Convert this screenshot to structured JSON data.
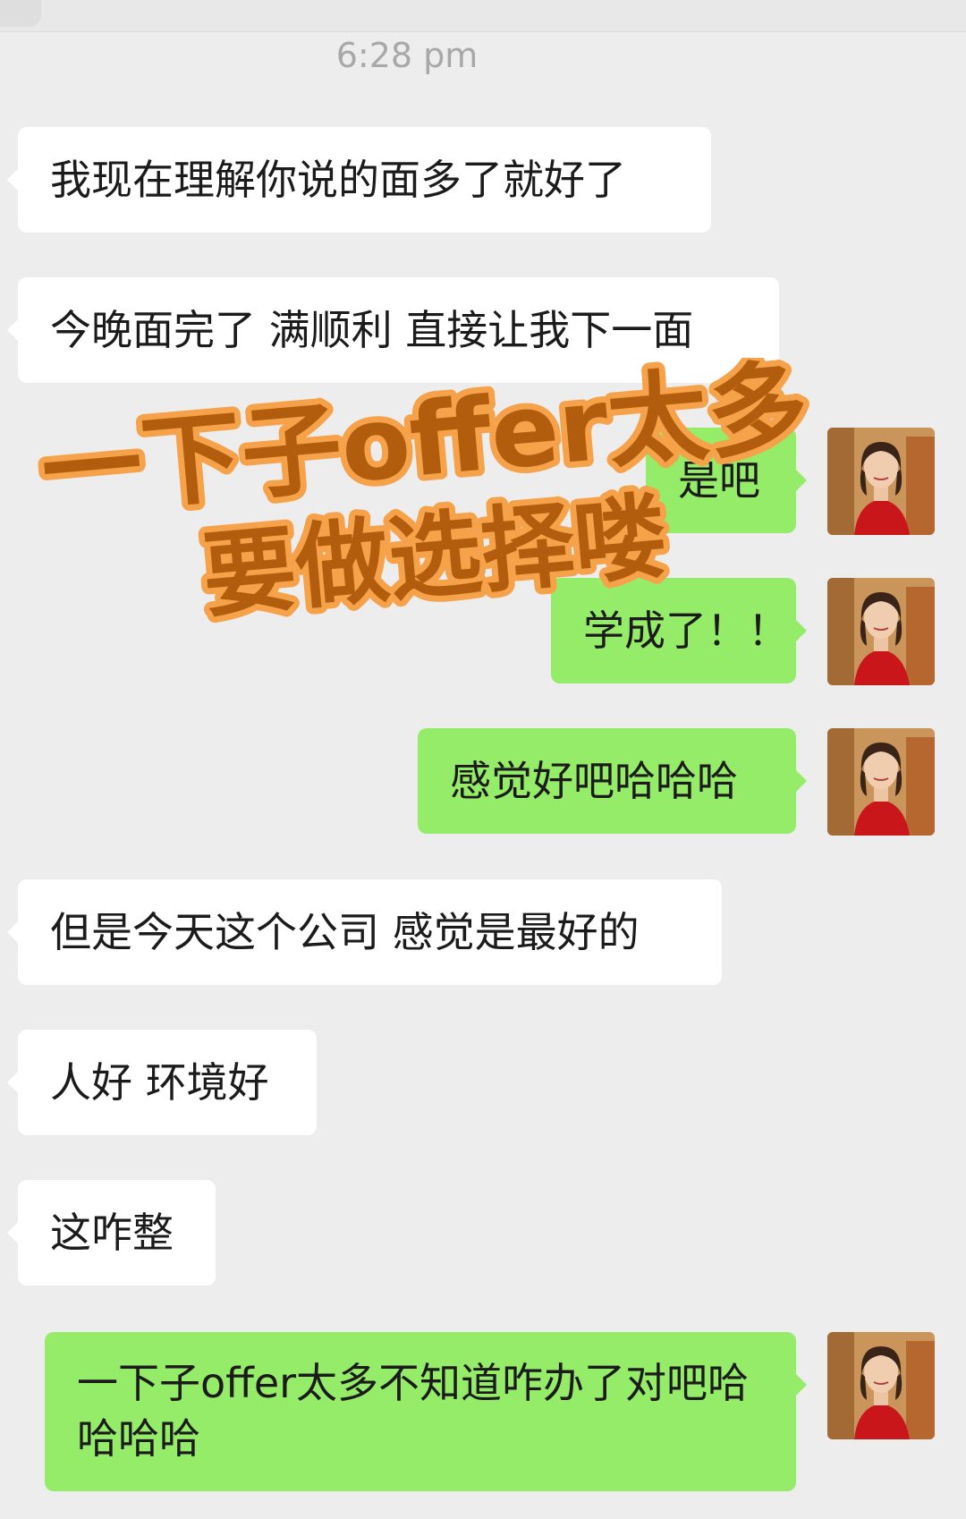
{
  "chat": {
    "timestamp": "6:28 pm",
    "messages": [
      {
        "side": "recv",
        "text": "我现在理解你说的面多了就好了"
      },
      {
        "side": "recv",
        "text": "今晚面完了 满顺利 直接让我下一面"
      },
      {
        "side": "sent",
        "text": "是吧"
      },
      {
        "side": "sent",
        "text": "学成了！！"
      },
      {
        "side": "sent",
        "text": "感觉好吧哈哈哈"
      },
      {
        "side": "recv",
        "text": "但是今天这个公司 感觉是最好的"
      },
      {
        "side": "recv",
        "text": "人好 环境好"
      },
      {
        "side": "recv",
        "text": "这咋整"
      },
      {
        "side": "sent",
        "text": "一下子offer太多不知道咋办了对吧哈哈哈哈"
      }
    ]
  },
  "overlay": {
    "line1": "一下子offer太多",
    "line2": "要做选择喽"
  },
  "colors": {
    "background": "#ededed",
    "sent_bubble": "#95ec69",
    "recv_bubble": "#ffffff",
    "overlay_fill": "#b25d0d",
    "overlay_stroke": "#f5a24a"
  },
  "avatar_icon": "person-avatar-icon"
}
